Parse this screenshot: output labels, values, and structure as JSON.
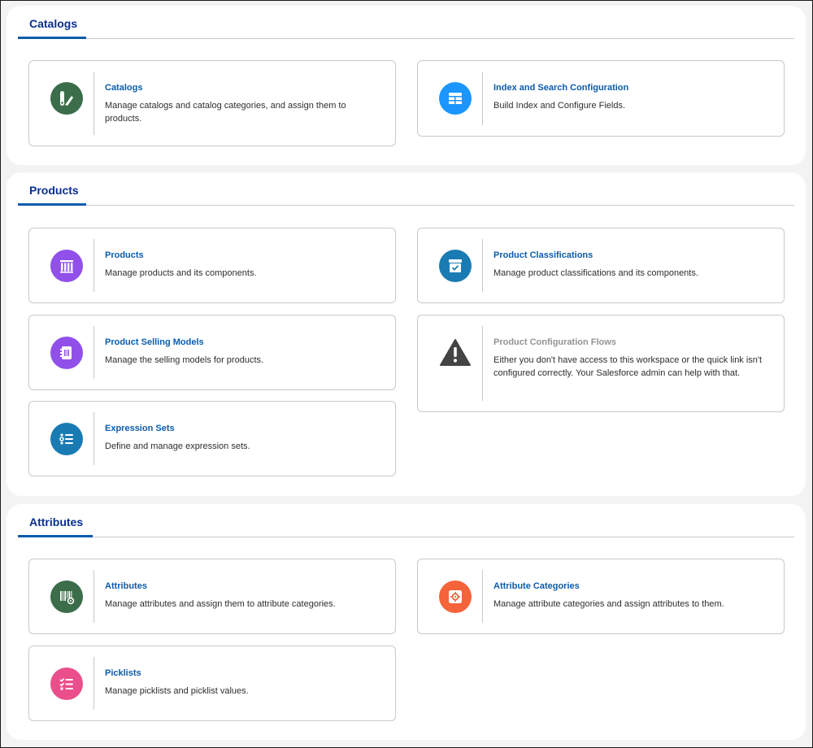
{
  "sections": [
    {
      "title": "Catalogs",
      "cards": [
        {
          "title": "Catalogs",
          "description": "Manage catalogs and catalog categories, and assign them to products.",
          "icon": "catalog-icon",
          "color": "#3b6d4a"
        },
        {
          "title": "Index and Search Configuration",
          "description": "Build Index and Configure Fields.",
          "icon": "table-icon",
          "color": "#1b96ff"
        }
      ]
    },
    {
      "title": "Products",
      "cards": [
        {
          "title": "Products",
          "description": "Manage products and its components.",
          "icon": "product-icon",
          "color": "#9050e9"
        },
        {
          "title": "Product Classifications",
          "description": "Manage product classifications and its components.",
          "icon": "classification-icon",
          "color": "#1a7bb3"
        },
        {
          "title": "Product Selling Models",
          "description": "Manage the selling models for products.",
          "icon": "selling-model-icon",
          "color": "#9050e9"
        },
        {
          "title": "Product Configuration Flows",
          "description": "Either you don't have access to this workspace or the quick link isn't configured correctly. Your Salesforce admin can help with that.",
          "icon": "warning-icon",
          "color": "#444444"
        },
        {
          "title": "Expression Sets",
          "description": "Define and manage expression sets.",
          "icon": "expression-set-icon",
          "color": "#1a7bb3"
        }
      ]
    },
    {
      "title": "Attributes",
      "cards": [
        {
          "title": "Attributes",
          "description": "Manage attributes and assign them to attribute categories.",
          "icon": "attribute-icon",
          "color": "#3b6d4a"
        },
        {
          "title": "Attribute Categories",
          "description": "Manage attribute categories and assign attributes to them.",
          "icon": "attribute-category-icon",
          "color": "#f4633a"
        },
        {
          "title": "Picklists",
          "description": "Manage picklists and picklist values.",
          "icon": "picklist-icon",
          "color": "#ea4f8c"
        }
      ]
    }
  ]
}
